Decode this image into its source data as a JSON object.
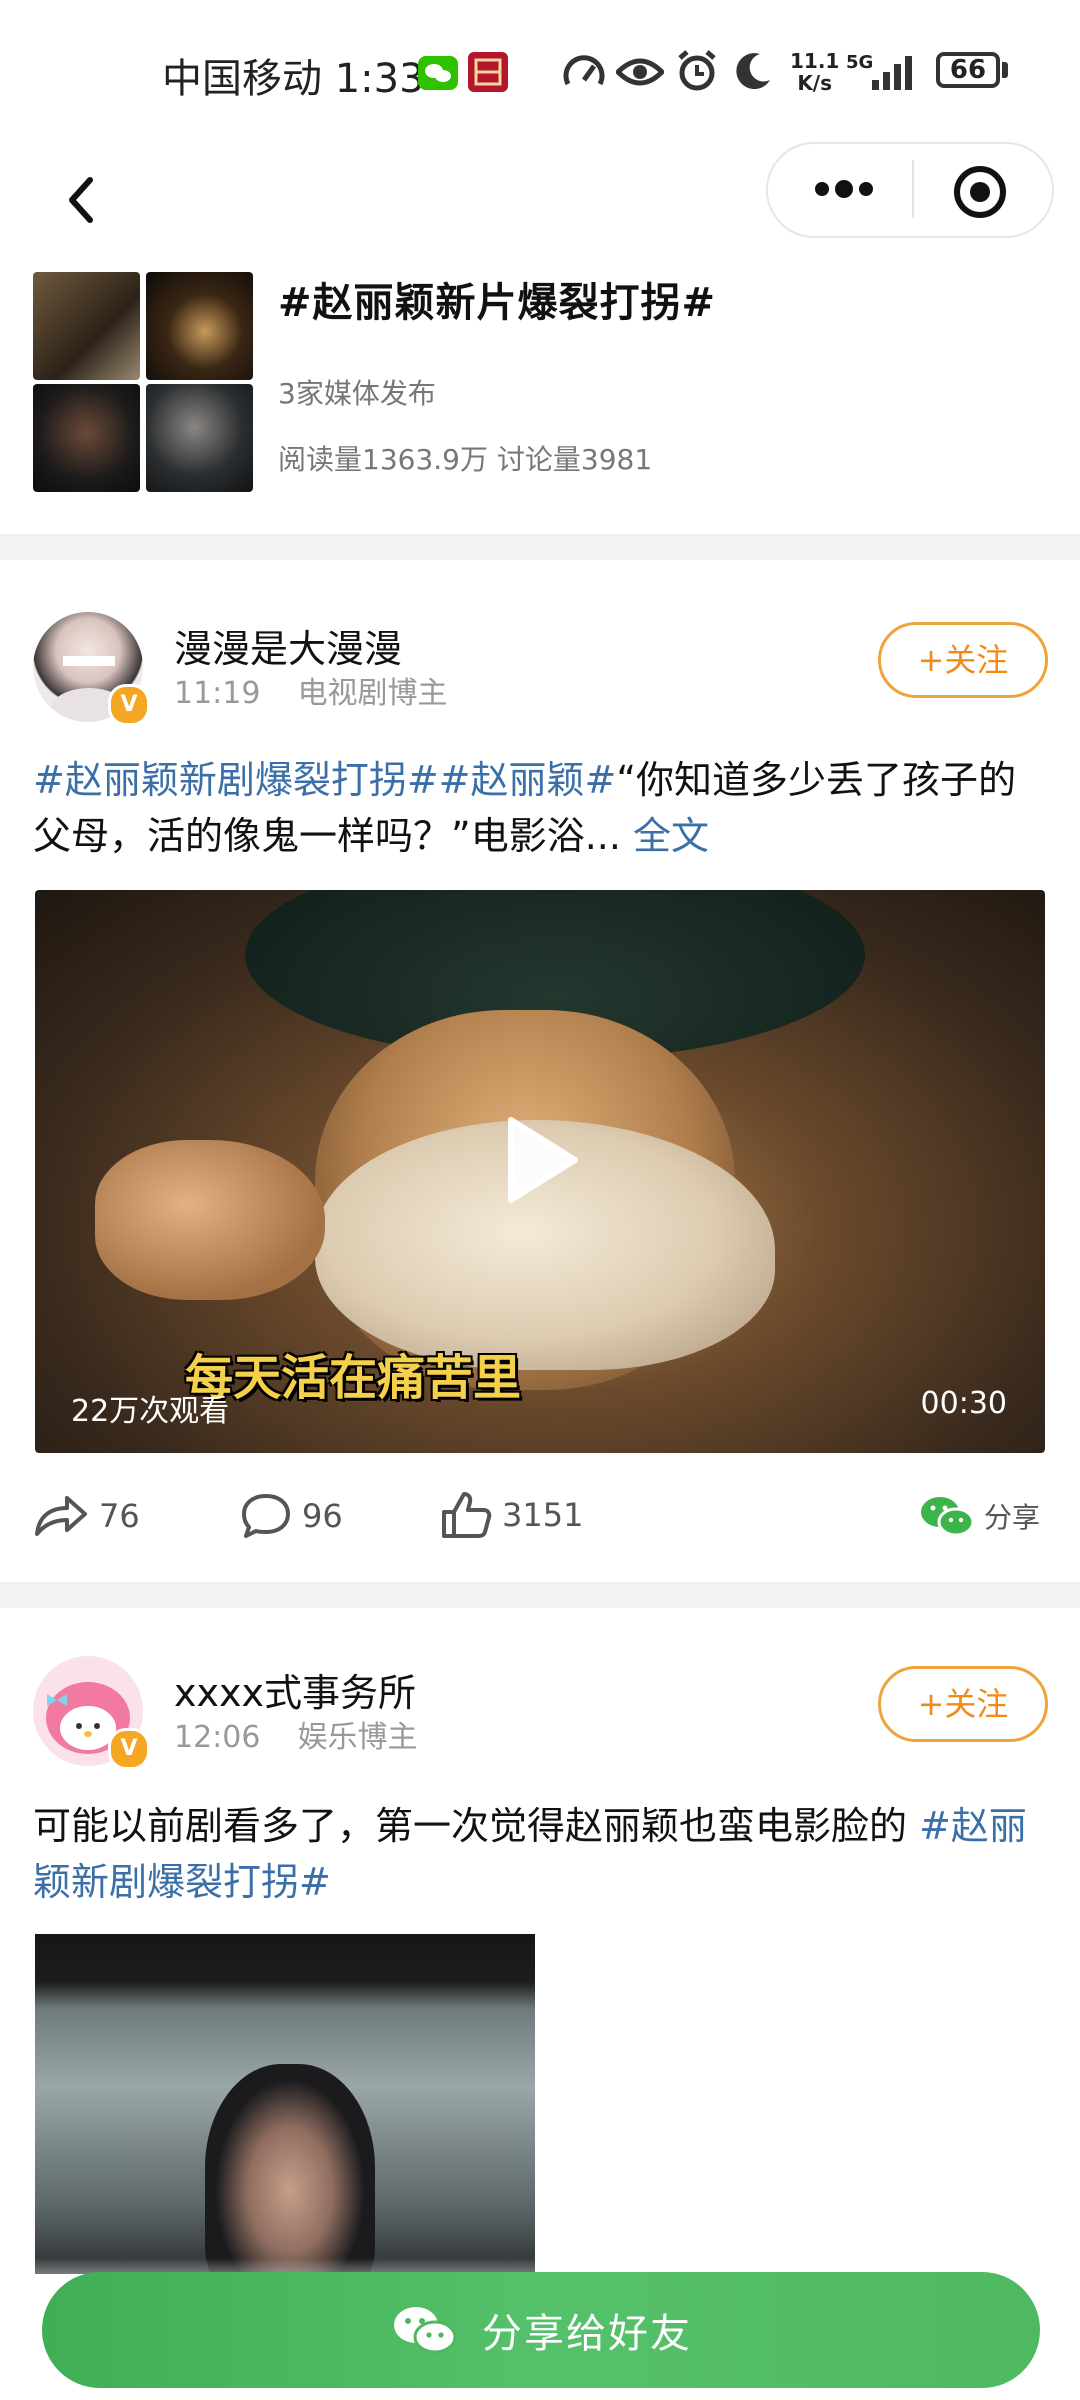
{
  "status_bar": {
    "carrier": "中国移动",
    "time": "1:33",
    "net_speed_value": "11.1",
    "net_speed_unit": "K/s",
    "network": "5G",
    "battery": "66"
  },
  "topic": {
    "title": "#赵丽颖新片爆裂打拐#",
    "media_count": "3家媒体发布",
    "stats": "阅读量1363.9万 讨论量3981"
  },
  "posts": [
    {
      "username": "漫漫是大漫漫",
      "time": "11:19",
      "role": "电视剧博主",
      "follow_label": "+关注",
      "tags": "#赵丽颖新剧爆裂打拐##赵丽颖#",
      "text": "“你知道多少丢了孩子的父母，活的像鬼一样吗？”电影浴...",
      "more_label": "全文",
      "video": {
        "subtitle": "每天活在痛苦里",
        "views": "22万次观看",
        "duration": "00:30"
      },
      "actions": {
        "repost": "76",
        "comment": "96",
        "like": "3151",
        "share": "分享"
      }
    },
    {
      "username": "xxxx式事务所",
      "time": "12:06",
      "role": "娱乐博主",
      "follow_label": "+关注",
      "text": "可能以前剧看多了，第一次觉得赵丽颖也蛮电影脸的 ",
      "tags": "#赵丽颖新剧爆裂打拐#"
    }
  ],
  "share_button": {
    "label": "分享给好友"
  },
  "colors": {
    "link": "#3b6fa8",
    "follow_orange": "#f0a33a",
    "share_green": "#4caf50",
    "verified_badge": "#f5a623"
  }
}
